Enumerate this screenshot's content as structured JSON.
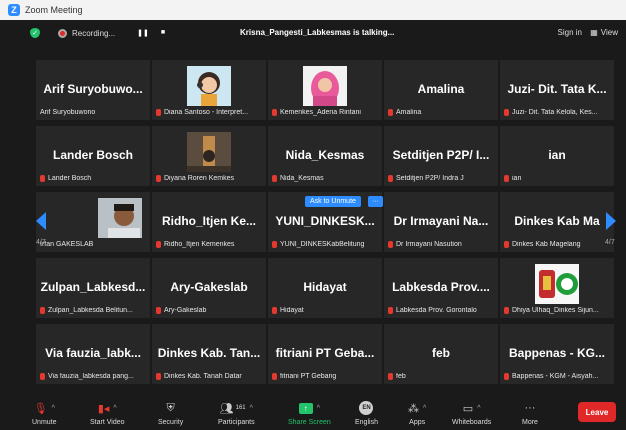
{
  "window": {
    "title": "Zoom Meeting"
  },
  "topbar": {
    "recording_label": "Recording...",
    "talking": "Krisna_Pangesti_Labkesmas is talking...",
    "sign_in": "Sign in",
    "view": "View"
  },
  "tiles": [
    {
      "name": "Arif  Suryobuwo...",
      "label": "Arif Suryobuwono",
      "muted": false
    },
    {
      "name": "",
      "label": "Diana Santoso - Interpret...",
      "muted": true,
      "photo": "diana"
    },
    {
      "name": "",
      "label": "Kemenkes_Aderia Rintani",
      "muted": true,
      "photo": "kemenkes"
    },
    {
      "name": "Amalina",
      "label": "Amalina",
      "muted": true
    },
    {
      "name": "Juzi- Dit. Tata K...",
      "label": "Juzi- Dit. Tata Kelola, Kes...",
      "muted": true
    },
    {
      "name": "Lander Bosch",
      "label": "Lander Bosch",
      "muted": true
    },
    {
      "name": "",
      "label": "Diyana Roren Kemkes",
      "muted": true,
      "photo": "diyana"
    },
    {
      "name": "Nida_Kesmas",
      "label": "Nida_Kesmas",
      "muted": true
    },
    {
      "name": "Setditjen P2P/ I...",
      "label": "Setditjen P2P/ Indra J",
      "muted": true
    },
    {
      "name": "ian",
      "label": "ian",
      "muted": true
    },
    {
      "name": "",
      "label": "Irfan GAKESLAB",
      "muted": false,
      "photo": "irfan"
    },
    {
      "name": "Ridho_Itjen Ke...",
      "label": "Ridho_Itjen Kemenkes",
      "muted": true
    },
    {
      "name": "YUNI_DINKESK...",
      "label": "YUNI_DINKESKabBelitung",
      "muted": true
    },
    {
      "name": "Dr Irmayani Na...",
      "label": "Dr Irmayani Nasution",
      "muted": true
    },
    {
      "name": "Dinkes Kab Ma",
      "label": "Dinkes Kab Magelang",
      "muted": true
    },
    {
      "name": "Zulpan_Labkesd...",
      "label": "Zulpan_Labkesda Belitun...",
      "muted": true
    },
    {
      "name": "Ary-Gakeslab",
      "label": "Ary-Gakeslab",
      "muted": true
    },
    {
      "name": "Hidayat",
      "label": "Hidayat",
      "muted": true
    },
    {
      "name": "Labkesda  Prov....",
      "label": "Labkesda Prov. Gorontalo",
      "muted": true
    },
    {
      "name": "",
      "label": "Dhiya Ulhaq_Dinkes Sijun...",
      "muted": true,
      "photo": "dhiya"
    },
    {
      "name": "Via fauzia_labk...",
      "label": "Via fauzia_labkesda pang...",
      "muted": true
    },
    {
      "name": "Dinkes Kab. Tan...",
      "label": "Dinkes Kab. Tanah Datar",
      "muted": true
    },
    {
      "name": "fitriani PT Geba...",
      "label": "fitriani PT Gebang",
      "muted": true
    },
    {
      "name": "feb",
      "label": "feb",
      "muted": true
    },
    {
      "name": "Bappenas - KG...",
      "label": "Bappenas - KGM - Aisyah...",
      "muted": true
    }
  ],
  "ask_to_unmute": "Ask to Unmute",
  "ask_more": "···",
  "pagination": {
    "left": "4/7",
    "right": "4/7"
  },
  "toolbar": {
    "unmute": "Unmute",
    "start_video": "Start Video",
    "security": "Security",
    "participants": "Participants",
    "participants_count": "161",
    "share_screen": "Share Screen",
    "english": "English",
    "english_icon": "EN",
    "apps": "Apps",
    "whiteboards": "Whiteboards",
    "more": "More",
    "leave": "Leave"
  },
  "colors": {
    "accent": "#2d8cff",
    "leave": "#e02828",
    "share": "#23c36b"
  }
}
